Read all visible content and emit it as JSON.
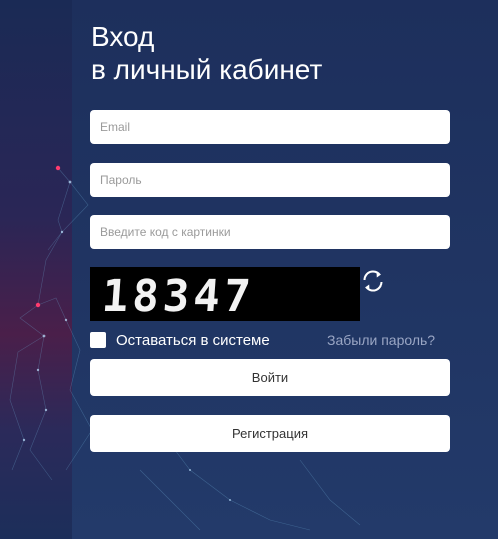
{
  "page": {
    "title_line1": "Вход",
    "title_line2": "в личный кабинет"
  },
  "form": {
    "email_placeholder": "Email",
    "password_placeholder": "Пароль",
    "captcha_placeholder": "Введите код с картинки",
    "captcha_code": "18347",
    "remember_label": "Оставаться в системе",
    "remember_checked": false,
    "forgot_link": "Забыли пароль?",
    "login_button": "Войти",
    "register_button": "Регистрация"
  },
  "icons": {
    "refresh": "refresh-icon",
    "checkbox": "checkbox-icon"
  },
  "colors": {
    "background": "#1f3361",
    "text": "#ffffff",
    "forgot_link": "#9aa6c4",
    "button_bg": "#ffffff"
  }
}
